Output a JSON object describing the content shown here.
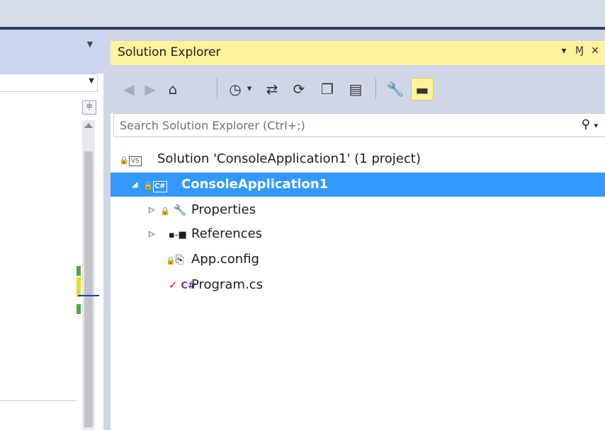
{
  "window": {
    "accent": "#3399ff",
    "title_bar_color": "#fff29d"
  },
  "left_panel": {
    "split_icon": "split-icon",
    "scroll_up_icon": "scroll-up-icon"
  },
  "solution_explorer": {
    "title": "Solution Explorer",
    "controls": {
      "dropdown_glyph": "▾",
      "pin_glyph": "Ɱ",
      "close_glyph": "✕"
    },
    "toolbar": {
      "back_glyph": "◀",
      "forward_glyph": "▶",
      "home_glyph": "⌂",
      "pending_changes_glyph": "◷",
      "pending_dropdown_glyph": "▾",
      "sync_glyph": "⇄",
      "refresh_glyph": "⟳",
      "collapse_all_glyph": "❐",
      "show_all_files_glyph": "▤",
      "properties_glyph": "🔧",
      "preview_glyph": "▬"
    },
    "search": {
      "placeholder": "Search Solution Explorer (Ctrl+;)",
      "icon_glyph": "⚲",
      "dropdown_glyph": "▾"
    },
    "tree": {
      "solution": "Solution 'ConsoleApplication1' (1 project)",
      "project": "ConsoleApplication1",
      "properties": "Properties",
      "references": "References",
      "app_config": "App.config",
      "program_cs": "Program.cs"
    }
  }
}
